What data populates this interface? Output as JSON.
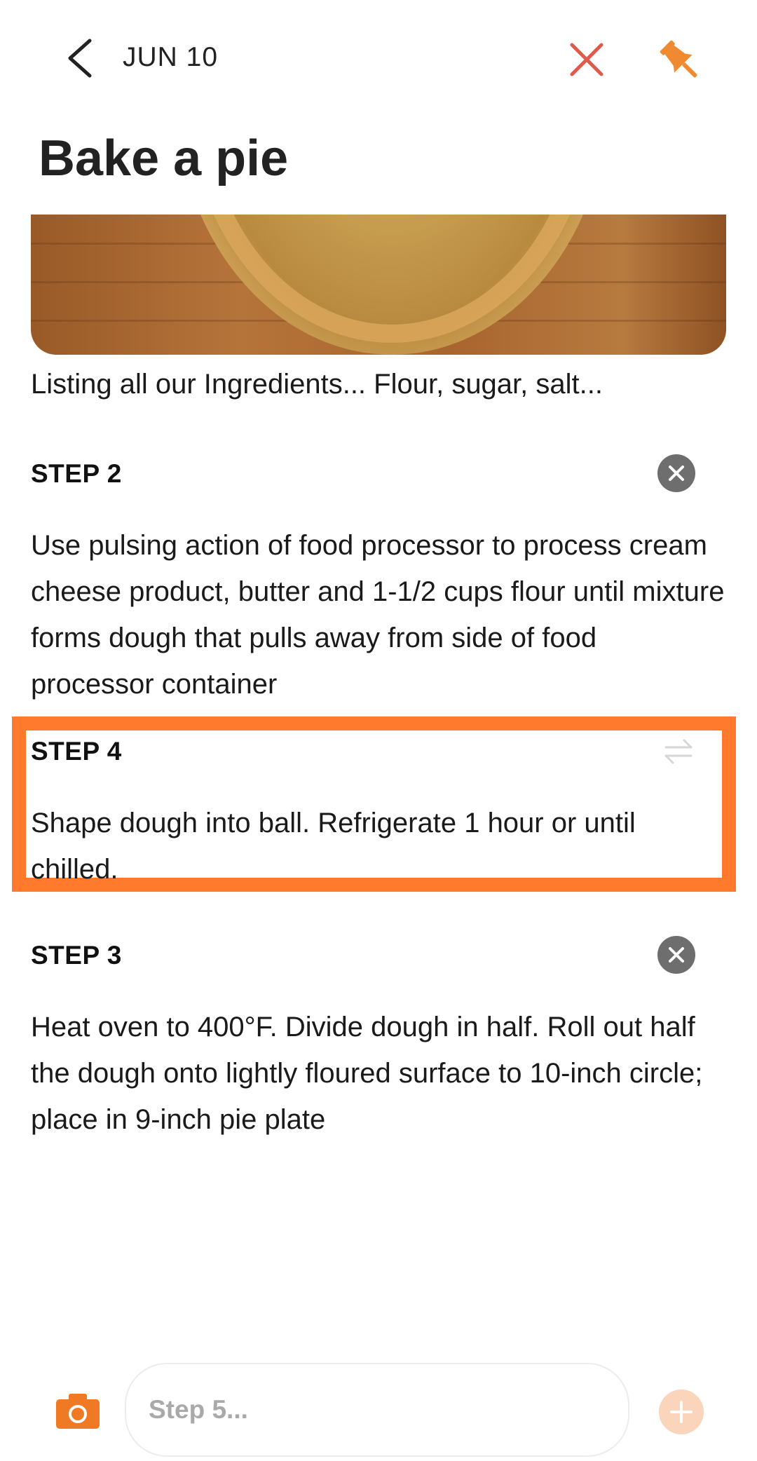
{
  "header": {
    "date": "JUN 10",
    "title": "Bake a pie"
  },
  "note": {
    "ingredients_text": "Listing all our Ingredients... Flour, sugar, salt..."
  },
  "steps": [
    {
      "label": "STEP 2",
      "text": "Use pulsing action of food processor to process cream cheese product, butter and 1-1/2 cups flour until mixture forms dough that pulls away from side of food processor container"
    },
    {
      "label": "STEP 4",
      "text": "Shape dough into ball. Refrigerate 1 hour or until chilled."
    },
    {
      "label": "STEP 3",
      "text": "Heat oven to 400°F. Divide dough in half. Roll out half the dough onto lightly floured surface to 10-inch circle; place in 9-inch pie plate"
    }
  ],
  "composer": {
    "placeholder": "Step 5..."
  },
  "icons": {
    "back": "chevron-left-icon",
    "discard": "close-icon",
    "pin": "pin-icon",
    "remove": "close-circle-icon",
    "reorder": "swap-icon",
    "camera": "camera-icon",
    "add": "plus-circle-icon"
  },
  "colors": {
    "accent": "#ff7a2c",
    "discard": "#e05a4a",
    "pin": "#f08a30",
    "remove_bg": "#6e6e6e",
    "add_bg": "#fbd4bc"
  }
}
